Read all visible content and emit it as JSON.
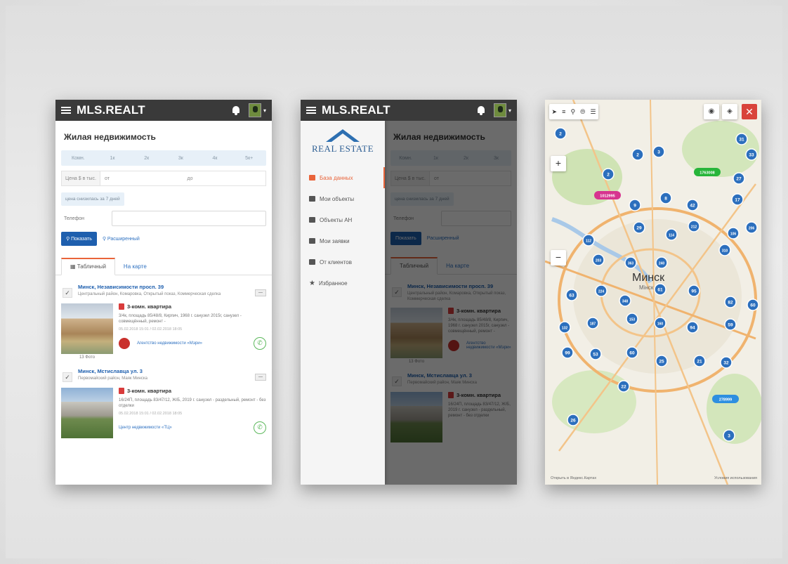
{
  "app": {
    "brand": "MLS.REALT"
  },
  "search": {
    "title": "Жилая недвижимость",
    "rooms": [
      "Комн.",
      "1к",
      "2к",
      "3к",
      "4к",
      "5к+"
    ],
    "price_label": "Цена $ в тыс.",
    "price_from": "от",
    "price_to": "до",
    "recent_chip": "цена снизилась за 7 дней",
    "phone_label": "Телефон",
    "show_button": "Показать",
    "extended_link": "Расширенный"
  },
  "tabs": {
    "table": "Табличный",
    "map": "На карте"
  },
  "listings": [
    {
      "address": "Минск, Независимости просп. 39",
      "district": "Центральный район, Комаровка, Открытый показ, Коммерческая сделка",
      "type": "3-комн. квартира",
      "desc": "3/4к, площадь 85/48/8, Кирпич, 1968 г. санузел 2015г, санузел - совмещённый, ремонт -",
      "date": "05.02.2018 15:01 / 02.02.2018 18:05",
      "photo_caption": "13 Фото",
      "agency": "Агентство недвижимости «Мэри»"
    },
    {
      "address": "Минск, Мстиславца ул. 3",
      "district": "Первомайский район, Маяк Минска",
      "type": "3-комн. квартира",
      "desc": "16/24П, площадь 83/47/12, Ж/Б, 2019 г. санузел - раздельный, ремонт - без отделки",
      "date": "05.02.2018 15:01 / 02.02.2018 18:05",
      "photo_caption": "",
      "agency": "Центр недвижимости «ТЦ»"
    }
  ],
  "drawer": {
    "logo": "REAL ESTATE",
    "items": [
      "База данных",
      "Мои объекты",
      "Объекты АН",
      "Мои заявки",
      "От клиентов",
      "Избранное"
    ]
  },
  "map": {
    "city": "Минск",
    "city_sub": "Мінск",
    "footer_left": "Открыть в Яндекс.Картах",
    "footer_right": "Условия использования",
    "clusters": [
      {
        "label": "2",
        "color": "#2c6fbd"
      },
      {
        "label": "2",
        "color": "#2c6fbd"
      },
      {
        "label": "3",
        "color": "#2c6fbd"
      },
      {
        "label": "2",
        "color": "#2c6fbd"
      },
      {
        "label": "31",
        "color": "#2c6fbd"
      },
      {
        "label": "33",
        "color": "#2c6fbd"
      },
      {
        "label": "9",
        "color": "#2c6fbd"
      },
      {
        "label": "17",
        "color": "#2c6fbd"
      },
      {
        "label": "8",
        "color": "#2c6fbd"
      },
      {
        "label": "42",
        "color": "#2c6fbd"
      },
      {
        "label": "27",
        "color": "#2c6fbd"
      },
      {
        "label": "29",
        "color": "#2c6fbd"
      },
      {
        "label": "112",
        "color": "#2c6fbd"
      },
      {
        "label": "114",
        "color": "#2c6fbd"
      },
      {
        "label": "212",
        "color": "#2c6fbd"
      },
      {
        "label": "106",
        "color": "#2c6fbd"
      },
      {
        "label": "310",
        "color": "#2c6fbd"
      },
      {
        "label": "206",
        "color": "#2c6fbd"
      },
      {
        "label": "203",
        "color": "#2c6fbd"
      },
      {
        "label": "363",
        "color": "#2c6fbd"
      },
      {
        "label": "240",
        "color": "#2c6fbd"
      },
      {
        "label": "63",
        "color": "#2c6fbd"
      },
      {
        "label": "224",
        "color": "#2c6fbd"
      },
      {
        "label": "348",
        "color": "#2c6fbd"
      },
      {
        "label": "61",
        "color": "#2c6fbd"
      },
      {
        "label": "95",
        "color": "#2c6fbd"
      },
      {
        "label": "82",
        "color": "#2c6fbd"
      },
      {
        "label": "132",
        "color": "#2c6fbd"
      },
      {
        "label": "187",
        "color": "#2c6fbd"
      },
      {
        "label": "153",
        "color": "#2c6fbd"
      },
      {
        "label": "160",
        "color": "#2c6fbd"
      },
      {
        "label": "94",
        "color": "#2c6fbd"
      },
      {
        "label": "59",
        "color": "#2c6fbd"
      },
      {
        "label": "60",
        "color": "#2c6fbd"
      },
      {
        "label": "99",
        "color": "#2c6fbd"
      },
      {
        "label": "53",
        "color": "#2c6fbd"
      },
      {
        "label": "60",
        "color": "#2c6fbd"
      },
      {
        "label": "25",
        "color": "#2c6fbd"
      },
      {
        "label": "21",
        "color": "#2c6fbd"
      },
      {
        "label": "32",
        "color": "#2c6fbd"
      },
      {
        "label": "22",
        "color": "#2c6fbd"
      },
      {
        "label": "26",
        "color": "#2c6fbd"
      },
      {
        "label": "3",
        "color": "#2c6fbd"
      }
    ],
    "tags": [
      {
        "label": "1012995",
        "color": "#d7348f"
      },
      {
        "label": "1763008",
        "color": "#27b53a"
      },
      {
        "label": "278999",
        "color": "#2d8fe0"
      }
    ]
  }
}
